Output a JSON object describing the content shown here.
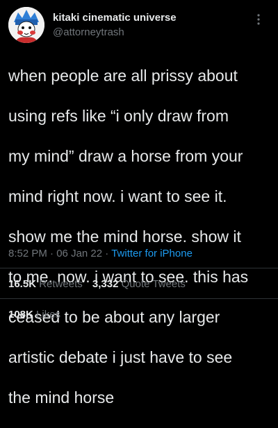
{
  "author": {
    "display_name": "kitaki cinematic universe",
    "handle": "@attorneytrash",
    "avatar_icon": "avatar-character-icon"
  },
  "tweet": {
    "lines": [
      "when people are all prissy about",
      "using refs like “i only draw from",
      "my mind” draw a horse from your",
      "mind right now. i want to see it.",
      "show me the mind horse. show it",
      "to me. now. i want to see. this has",
      "ceased to be about any larger",
      "artistic debate i just have to see",
      "the mind horse"
    ],
    "time": "8:52 PM",
    "date": "06 Jan 22",
    "source": "Twitter for iPhone"
  },
  "stats": {
    "retweets_count": "16.5K",
    "retweets_label": "Retweets",
    "quotes_count": "3,332",
    "quotes_label": "Quote Tweets",
    "likes_count": "108K",
    "likes_label": "Likes"
  },
  "colors": {
    "background": "#000000",
    "text": "#e7e9ea",
    "secondary": "#71767b",
    "link": "#1d9bf0",
    "divider": "#2f3336"
  }
}
